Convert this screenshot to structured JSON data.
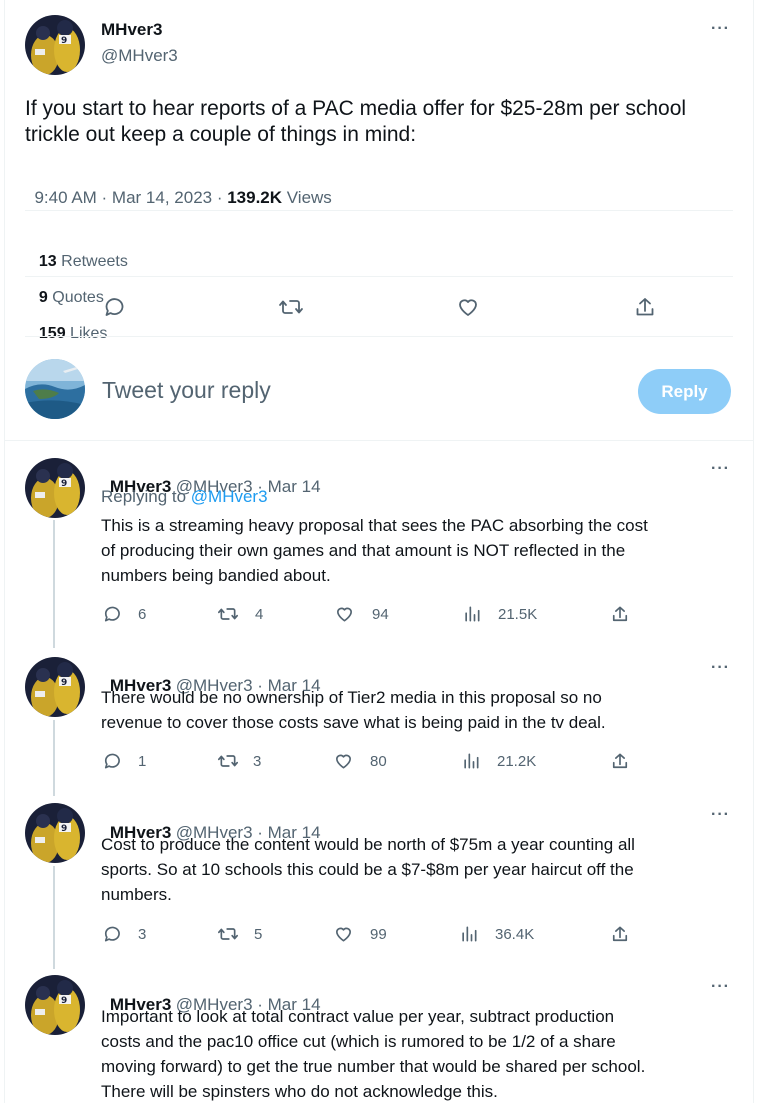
{
  "main_tweet": {
    "name": "MHver3",
    "handle": "@MHver3",
    "text_line1": "If you start to hear reports of a PAC media offer for $25-28m per school",
    "text_line2": "trickle out keep a couple of things in mind:",
    "time": "9:40 AM · Mar 14, 2023 · ",
    "views_count": "139.2K",
    "views_label": " Views",
    "stats": [
      {
        "count": "13",
        "label": " Retweets"
      },
      {
        "count": "9",
        "label": " Quotes"
      },
      {
        "count": "159",
        "label": " Likes"
      }
    ],
    "more": "···"
  },
  "reply_box": {
    "placeholder": "Tweet your reply",
    "button": "Reply"
  },
  "replies": [
    {
      "name": "MHver3",
      "meta": "@MHver3 · Mar 14",
      "replying_to_prefix": "Replying to ",
      "replying_to_handle": "@MHver3",
      "lines": [
        "This is a streaming heavy proposal that sees the PAC absorbing the cost",
        "of producing their own games and that amount is NOT reflected in the",
        "numbers being bandied about."
      ],
      "replies": "6",
      "retweets": "4",
      "likes": "94",
      "views": "21.5K"
    },
    {
      "name": "MHver3",
      "meta": "@MHver3 · Mar 14",
      "lines": [
        "There would be no ownership of Tier2 media in this proposal so no",
        "revenue to cover those costs save what is being paid in the tv deal."
      ],
      "replies": "1",
      "retweets": "3",
      "likes": "80",
      "views": "21.2K"
    },
    {
      "name": "MHver3",
      "meta": "@MHver3 · Mar 14",
      "lines": [
        "Cost to produce the content would be north of $75m a year counting all",
        "sports. So at 10 schools this could be a $7-$8m per year haircut off the",
        "numbers."
      ],
      "replies": "3",
      "retweets": "5",
      "likes": "99",
      "views": "36.4K"
    },
    {
      "name": "MHver3",
      "meta": "@MHver3 · Mar 14",
      "lines": [
        "Important to look at total contract value per year, subtract production",
        "costs and the pac10 office cut (which is rumored to be 1/2 of a share",
        "moving forward) to get the true number that would be shared per school.",
        "There will be spinsters who do not acknowledge this."
      ]
    }
  ],
  "colors": {
    "accent": "#1d9bf0",
    "reply_button_disabled": "#8ecdf8",
    "secondary_text": "#536471",
    "divider": "#eff3f4"
  }
}
